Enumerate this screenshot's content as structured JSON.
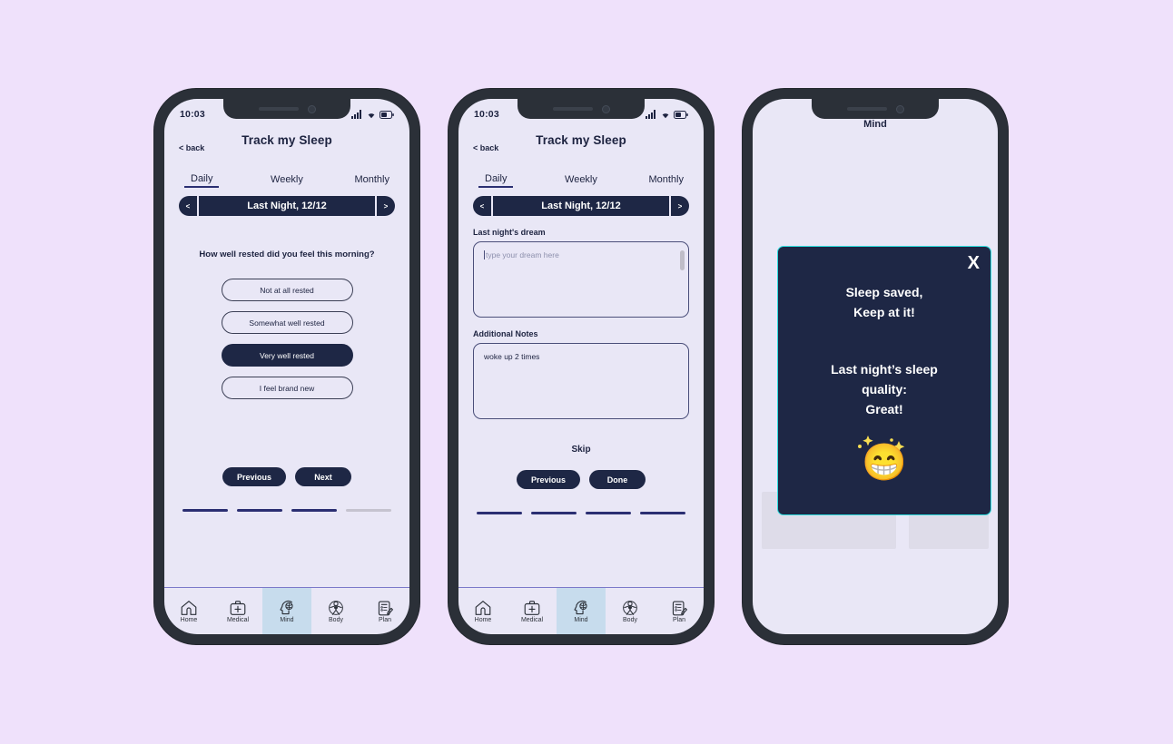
{
  "background_color": "#efe1fb",
  "theme": {
    "screen_bg": "#e9e7f6",
    "navy": "#1e2745",
    "accent_cyan": "#2fdfe0",
    "nav_active_bg": "#c7dced",
    "step_active": "#2b2f72",
    "step_inactive": "#c5c3cf"
  },
  "phones": [
    {
      "id": "phone-1",
      "status_bar": {
        "time": "10:03",
        "icons": [
          "signal-icon",
          "wifi-icon",
          "battery-icon"
        ]
      },
      "header": {
        "back_label": "< back",
        "title": "Track my Sleep"
      },
      "tabs": [
        {
          "label": "Daily",
          "active": true
        },
        {
          "label": "Weekly",
          "active": false
        },
        {
          "label": "Monthly",
          "active": false
        }
      ],
      "date_selector": {
        "prev": "<",
        "label": "Last Night, 12/12",
        "next": ">"
      },
      "question": "How well rested did you feel this morning?",
      "options": [
        {
          "label": "Not at all rested",
          "selected": false
        },
        {
          "label": "Somewhat well rested",
          "selected": false
        },
        {
          "label": "Very well rested",
          "selected": true
        },
        {
          "label": "I feel brand new",
          "selected": false
        }
      ],
      "actions": {
        "previous": "Previous",
        "next": "Next"
      },
      "steps": [
        true,
        true,
        true,
        false
      ]
    },
    {
      "id": "phone-2",
      "status_bar": {
        "time": "10:03",
        "icons": [
          "signal-icon",
          "wifi-icon",
          "battery-icon"
        ]
      },
      "header": {
        "back_label": "< back",
        "title": "Track my Sleep"
      },
      "tabs": [
        {
          "label": "Daily",
          "active": true
        },
        {
          "label": "Weekly",
          "active": false
        },
        {
          "label": "Monthly",
          "active": false
        }
      ],
      "date_selector": {
        "prev": "<",
        "label": "Last Night, 12/12",
        "next": ">"
      },
      "dream": {
        "label": "Last night's dream",
        "value": "",
        "placeholder": "type your dream here"
      },
      "notes": {
        "label": "Additional Notes",
        "value": "woke up 2 times",
        "placeholder": ""
      },
      "skip_label": "Skip",
      "actions": {
        "previous": "Previous",
        "done": "Done"
      },
      "steps": [
        true,
        true,
        true,
        true
      ]
    },
    {
      "id": "phone-3",
      "title": "Mind",
      "modal": {
        "close_label": "X",
        "heading_line1": "Sleep saved,",
        "heading_line2": "Keep at it!",
        "subheading_line1": "Last night’s sleep",
        "subheading_line2": "quality:",
        "subheading_line3": "Great!",
        "emoji": "😁",
        "emoji_name": "grinning-face-emoji",
        "sparkles": true
      },
      "placeholder_cards": 2
    }
  ],
  "bottom_nav": [
    {
      "label": "Home",
      "icon": "home-icon",
      "active": false
    },
    {
      "label": "Medical",
      "icon": "medical-briefcase-icon",
      "active": false
    },
    {
      "label": "Mind",
      "icon": "head-brain-icon",
      "active": true
    },
    {
      "label": "Body",
      "icon": "body-figure-icon",
      "active": false
    },
    {
      "label": "Plan",
      "icon": "clipboard-pencil-icon",
      "active": false
    }
  ]
}
